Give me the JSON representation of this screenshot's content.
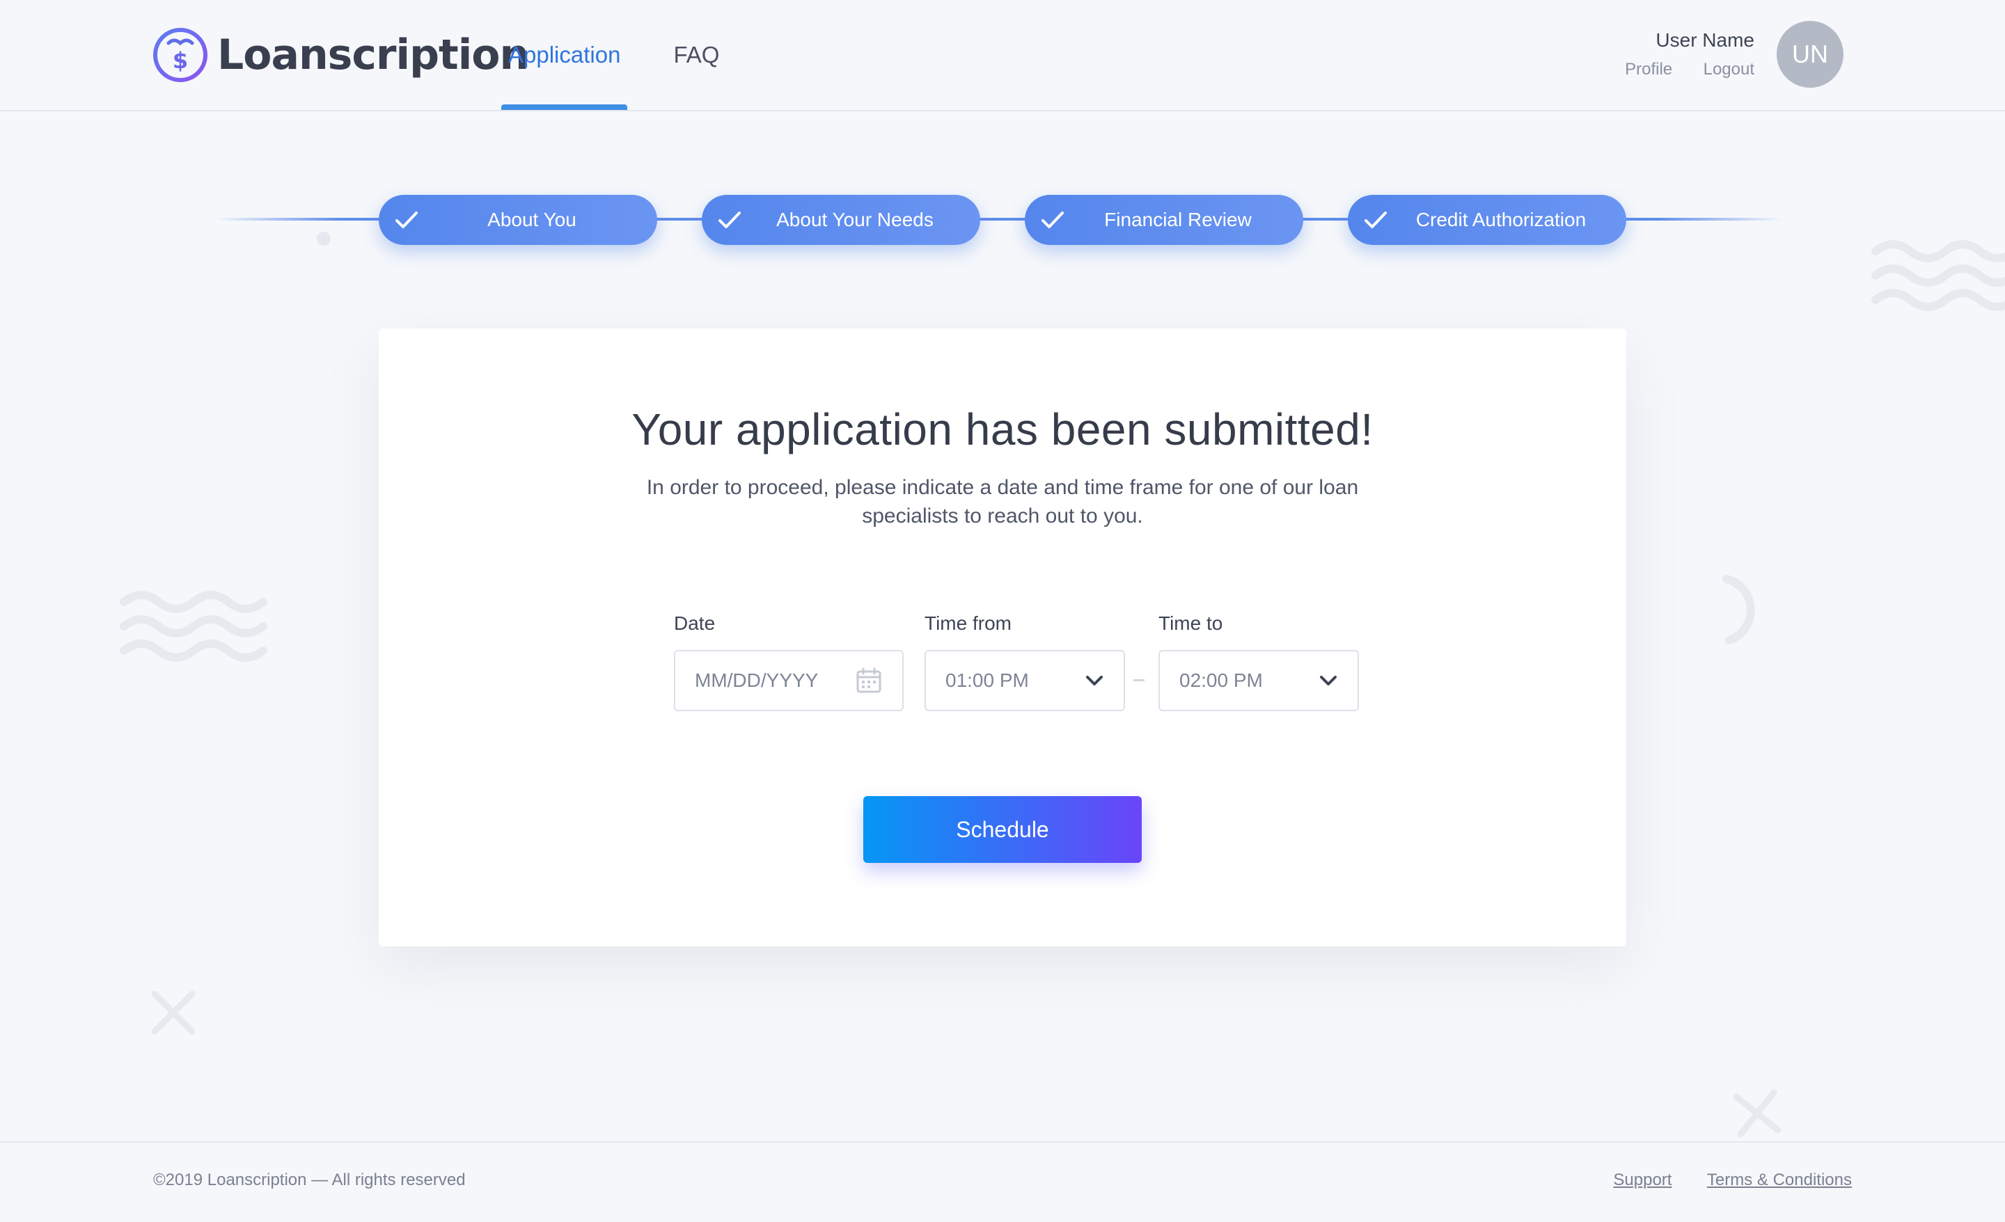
{
  "header": {
    "brand": "Loanscription",
    "nav": [
      {
        "label": "Application",
        "active": true
      },
      {
        "label": "FAQ",
        "active": false
      }
    ],
    "user": {
      "name": "User Name",
      "profile_link": "Profile",
      "logout_link": "Logout",
      "avatar_initials": "UN"
    }
  },
  "stepper": {
    "steps": [
      {
        "label": "About You",
        "status": "complete"
      },
      {
        "label": "About Your Needs",
        "status": "complete"
      },
      {
        "label": "Financial Review",
        "status": "complete"
      },
      {
        "label": "Credit Authorization",
        "status": "complete"
      }
    ]
  },
  "card": {
    "title": "Your application has been submitted!",
    "description": "In order to proceed, please indicate a date and time frame for one of our loan specialists to reach out to you.",
    "date": {
      "label": "Date",
      "placeholder": "MM/DD/YYYY",
      "icon": "calendar-icon"
    },
    "time_from": {
      "label": "Time from",
      "value": "01:00 PM",
      "icon": "chevron-down-icon"
    },
    "time_to": {
      "label": "Time to",
      "value": "02:00 PM",
      "icon": "chevron-down-icon"
    },
    "schedule_label": "Schedule"
  },
  "footer": {
    "copyright": "©2019 Loanscription — All rights reserved",
    "support_link": "Support",
    "terms_link": "Terms & Conditions"
  },
  "colors": {
    "accent": "#2f74de",
    "step": "#5f8cec",
    "button_start": "#0597f5",
    "button_end": "#6a45f8",
    "background": "#f5f7fa"
  }
}
